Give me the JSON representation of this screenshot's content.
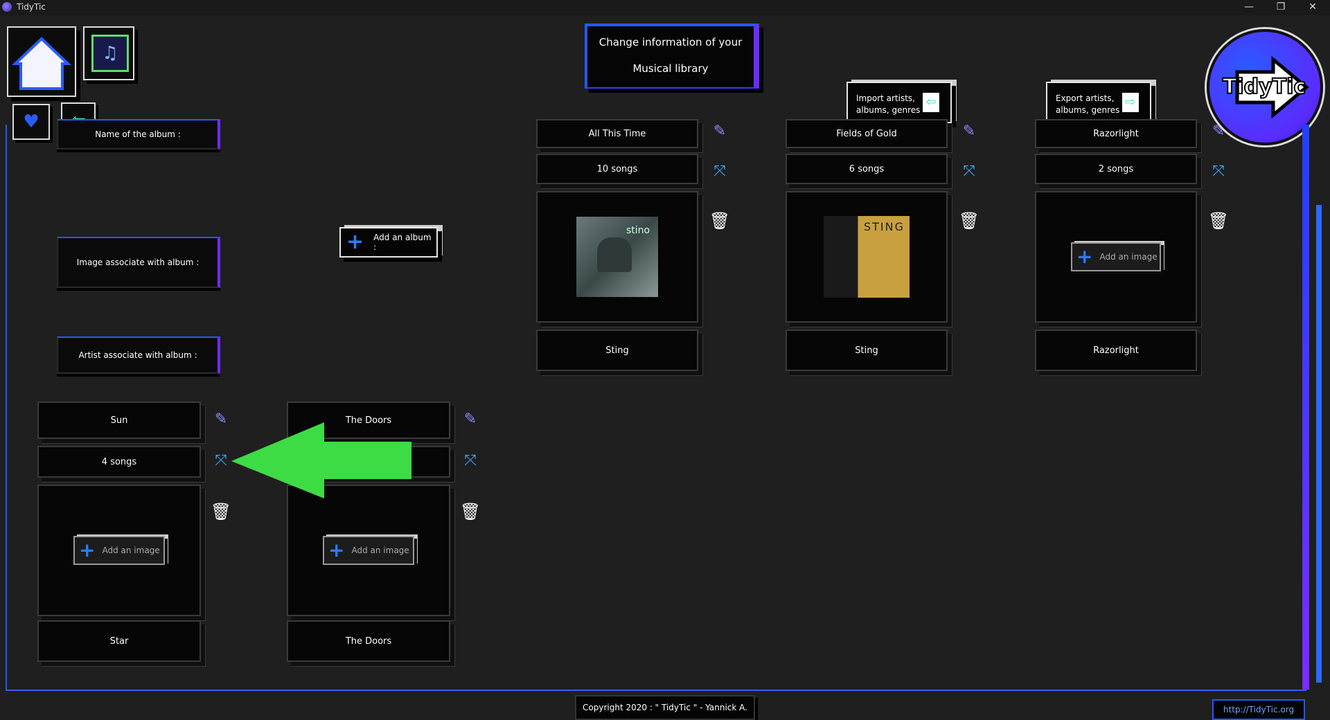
{
  "window": {
    "title": "TidyTic",
    "controls": [
      "—",
      "❐",
      "✕"
    ]
  },
  "header": {
    "title_line1": "Change information of your",
    "title_line2": "Musical library",
    "import_label_1": "Import artists,",
    "import_label_2": "albums, genres",
    "export_label_1": "Export artists,",
    "export_label_2": "albums, genres",
    "logo_text": "TidyTic"
  },
  "form": {
    "name_label": "Name of the album :",
    "image_label": "Image associate with album :",
    "artist_label": "Artist associate with album :",
    "add_album_label": "Add an album :"
  },
  "add_image_label": "Add an image",
  "albums_top": [
    {
      "name": "All This Time",
      "songs": "10 songs",
      "artist": "Sting",
      "has_image": true,
      "image": "sting1"
    },
    {
      "name": "Fields of Gold",
      "songs": "6 songs",
      "artist": "Sting",
      "has_image": true,
      "image": "sting2"
    },
    {
      "name": "Razorlight",
      "songs": "2 songs",
      "artist": "Razorlight",
      "has_image": false
    }
  ],
  "albums_bottom": [
    {
      "name": "Sun",
      "songs": "4 songs",
      "artist": "Star",
      "has_image": false
    },
    {
      "name": "The Doors",
      "songs": "",
      "artist": "The Doors",
      "has_image": false
    }
  ],
  "footer": {
    "copyright": "Copyright 2020 : \" TidyTic \" - Yannick A.",
    "link": "http://TidyTic.org"
  },
  "colors": {
    "accent_blue": "#1e5bff",
    "accent_purple": "#6a2cff",
    "arrow_green": "#3ddc44"
  }
}
